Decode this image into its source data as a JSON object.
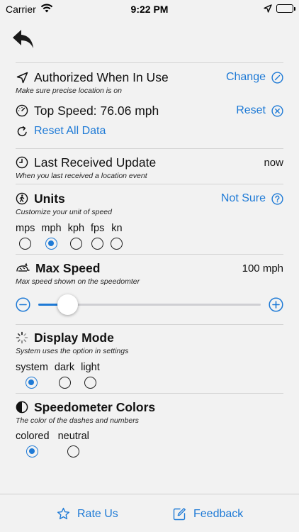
{
  "status_bar": {
    "carrier": "Carrier",
    "time": "9:22 PM"
  },
  "location": {
    "title": "Authorized When In Use",
    "subtitle": "Make sure precise location is on",
    "action": "Change"
  },
  "top_speed": {
    "label": "Top Speed: ",
    "value": "76.06 mph",
    "action": "Reset"
  },
  "reset_all": {
    "label": "Reset All Data"
  },
  "last_update": {
    "title": "Last Received Update",
    "subtitle": "When you last received a location event",
    "value": "now"
  },
  "units": {
    "title": "Units",
    "subtitle": "Customize your unit of speed",
    "action": "Not Sure",
    "options": [
      "mps",
      "mph",
      "kph",
      "fps",
      "kn"
    ],
    "selected": "mph"
  },
  "max_speed": {
    "title": "Max Speed",
    "subtitle": "Max speed shown on the speedomter",
    "value": "100 mph",
    "slider_fraction": 0.13
  },
  "display_mode": {
    "title": "Display Mode",
    "subtitle": "System uses the option in settings",
    "options": [
      "system",
      "dark",
      "light"
    ],
    "selected": "system"
  },
  "speedometer_colors": {
    "title": "Speedometer Colors",
    "subtitle": "The color of the dashes and numbers",
    "options": [
      "colored",
      "neutral"
    ],
    "selected": "colored"
  },
  "bottom_bar": {
    "rate_label": "Rate Us",
    "feedback_label": "Feedback"
  },
  "colors": {
    "accent": "#1e7ad6",
    "background": "#f2f2f2"
  }
}
